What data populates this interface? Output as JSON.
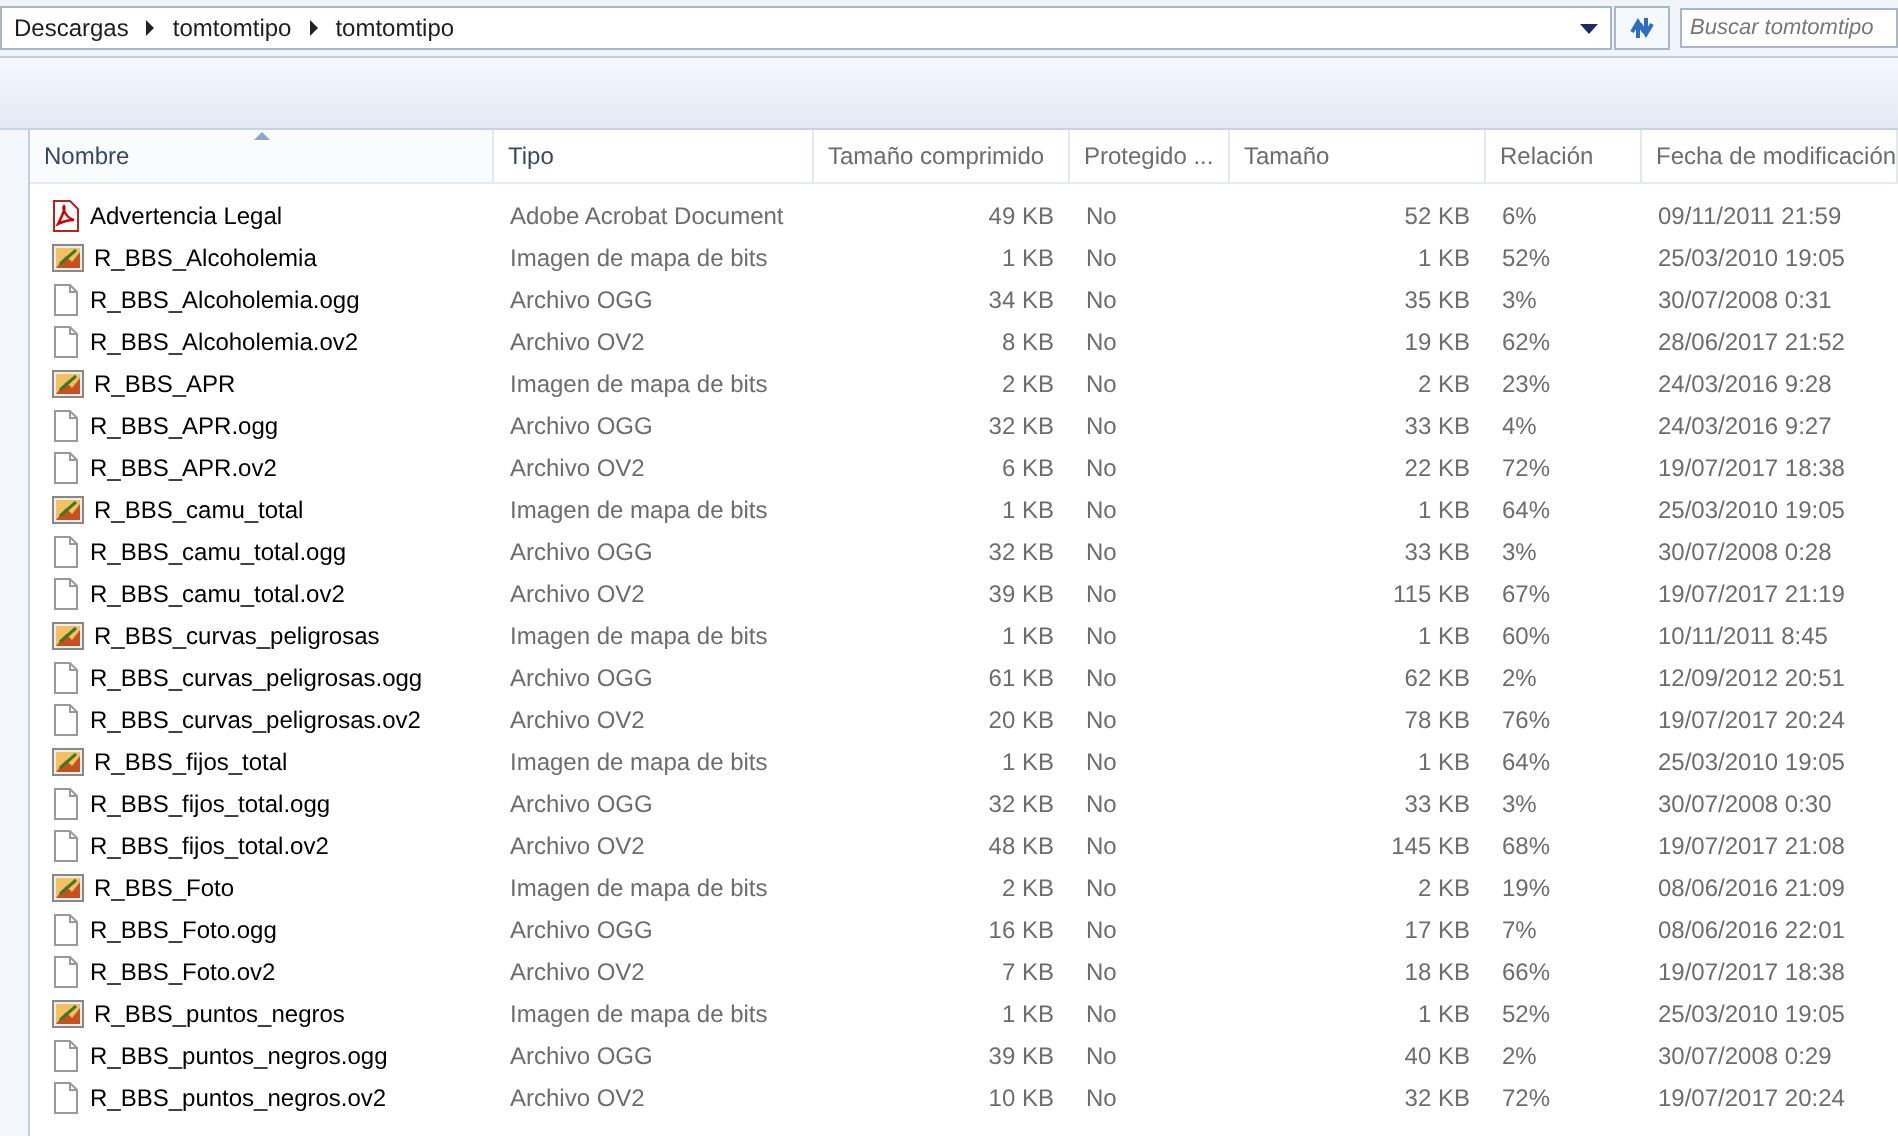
{
  "breadcrumb": [
    "Descargas",
    "tomtomtipo",
    "tomtomtipo"
  ],
  "search": {
    "placeholder": "Buscar tomtomtipo"
  },
  "columns": [
    {
      "label": "Nombre",
      "sorted": true
    },
    {
      "label": "Tipo",
      "sorted": false
    },
    {
      "label": "Tamaño comprimido",
      "sorted": false
    },
    {
      "label": "Protegido ...",
      "sorted": false
    },
    {
      "label": "Tamaño",
      "sorted": false
    },
    {
      "label": "Relación",
      "sorted": false
    },
    {
      "label": "Fecha de modificación",
      "sorted": false
    }
  ],
  "rows": [
    {
      "kind": "pdf",
      "name": "Advertencia Legal",
      "type": "Adobe Acrobat Document",
      "compressed": "49 KB",
      "protected": "No",
      "size": "52 KB",
      "ratio": "6%",
      "date": "09/11/2011 21:59"
    },
    {
      "kind": "image",
      "name": "R_BBS_Alcoholemia",
      "type": "Imagen de mapa de bits",
      "compressed": "1 KB",
      "protected": "No",
      "size": "1 KB",
      "ratio": "52%",
      "date": "25/03/2010 19:05"
    },
    {
      "kind": "file",
      "name": "R_BBS_Alcoholemia.ogg",
      "type": "Archivo OGG",
      "compressed": "34 KB",
      "protected": "No",
      "size": "35 KB",
      "ratio": "3%",
      "date": "30/07/2008 0:31"
    },
    {
      "kind": "file",
      "name": "R_BBS_Alcoholemia.ov2",
      "type": "Archivo OV2",
      "compressed": "8 KB",
      "protected": "No",
      "size": "19 KB",
      "ratio": "62%",
      "date": "28/06/2017 21:52"
    },
    {
      "kind": "image",
      "name": "R_BBS_APR",
      "type": "Imagen de mapa de bits",
      "compressed": "2 KB",
      "protected": "No",
      "size": "2 KB",
      "ratio": "23%",
      "date": "24/03/2016 9:28"
    },
    {
      "kind": "file",
      "name": "R_BBS_APR.ogg",
      "type": "Archivo OGG",
      "compressed": "32 KB",
      "protected": "No",
      "size": "33 KB",
      "ratio": "4%",
      "date": "24/03/2016 9:27"
    },
    {
      "kind": "file",
      "name": "R_BBS_APR.ov2",
      "type": "Archivo OV2",
      "compressed": "6 KB",
      "protected": "No",
      "size": "22 KB",
      "ratio": "72%",
      "date": "19/07/2017 18:38"
    },
    {
      "kind": "image",
      "name": "R_BBS_camu_total",
      "type": "Imagen de mapa de bits",
      "compressed": "1 KB",
      "protected": "No",
      "size": "1 KB",
      "ratio": "64%",
      "date": "25/03/2010 19:05"
    },
    {
      "kind": "file",
      "name": "R_BBS_camu_total.ogg",
      "type": "Archivo OGG",
      "compressed": "32 KB",
      "protected": "No",
      "size": "33 KB",
      "ratio": "3%",
      "date": "30/07/2008 0:28"
    },
    {
      "kind": "file",
      "name": "R_BBS_camu_total.ov2",
      "type": "Archivo OV2",
      "compressed": "39 KB",
      "protected": "No",
      "size": "115 KB",
      "ratio": "67%",
      "date": "19/07/2017 21:19"
    },
    {
      "kind": "image",
      "name": "R_BBS_curvas_peligrosas",
      "type": "Imagen de mapa de bits",
      "compressed": "1 KB",
      "protected": "No",
      "size": "1 KB",
      "ratio": "60%",
      "date": "10/11/2011 8:45"
    },
    {
      "kind": "file",
      "name": "R_BBS_curvas_peligrosas.ogg",
      "type": "Archivo OGG",
      "compressed": "61 KB",
      "protected": "No",
      "size": "62 KB",
      "ratio": "2%",
      "date": "12/09/2012 20:51"
    },
    {
      "kind": "file",
      "name": "R_BBS_curvas_peligrosas.ov2",
      "type": "Archivo OV2",
      "compressed": "20 KB",
      "protected": "No",
      "size": "78 KB",
      "ratio": "76%",
      "date": "19/07/2017 20:24"
    },
    {
      "kind": "image",
      "name": "R_BBS_fijos_total",
      "type": "Imagen de mapa de bits",
      "compressed": "1 KB",
      "protected": "No",
      "size": "1 KB",
      "ratio": "64%",
      "date": "25/03/2010 19:05"
    },
    {
      "kind": "file",
      "name": "R_BBS_fijos_total.ogg",
      "type": "Archivo OGG",
      "compressed": "32 KB",
      "protected": "No",
      "size": "33 KB",
      "ratio": "3%",
      "date": "30/07/2008 0:30"
    },
    {
      "kind": "file",
      "name": "R_BBS_fijos_total.ov2",
      "type": "Archivo OV2",
      "compressed": "48 KB",
      "protected": "No",
      "size": "145 KB",
      "ratio": "68%",
      "date": "19/07/2017 21:08"
    },
    {
      "kind": "image",
      "name": "R_BBS_Foto",
      "type": "Imagen de mapa de bits",
      "compressed": "2 KB",
      "protected": "No",
      "size": "2 KB",
      "ratio": "19%",
      "date": "08/06/2016 21:09"
    },
    {
      "kind": "file",
      "name": "R_BBS_Foto.ogg",
      "type": "Archivo OGG",
      "compressed": "16 KB",
      "protected": "No",
      "size": "17 KB",
      "ratio": "7%",
      "date": "08/06/2016 22:01"
    },
    {
      "kind": "file",
      "name": "R_BBS_Foto.ov2",
      "type": "Archivo OV2",
      "compressed": "7 KB",
      "protected": "No",
      "size": "18 KB",
      "ratio": "66%",
      "date": "19/07/2017 18:38"
    },
    {
      "kind": "image",
      "name": "R_BBS_puntos_negros",
      "type": "Imagen de mapa de bits",
      "compressed": "1 KB",
      "protected": "No",
      "size": "1 KB",
      "ratio": "52%",
      "date": "25/03/2010 19:05"
    },
    {
      "kind": "file",
      "name": "R_BBS_puntos_negros.ogg",
      "type": "Archivo OGG",
      "compressed": "39 KB",
      "protected": "No",
      "size": "40 KB",
      "ratio": "2%",
      "date": "30/07/2008 0:29"
    },
    {
      "kind": "file",
      "name": "R_BBS_puntos_negros.ov2",
      "type": "Archivo OV2",
      "compressed": "10 KB",
      "protected": "No",
      "size": "32 KB",
      "ratio": "72%",
      "date": "19/07/2017 20:24"
    }
  ]
}
